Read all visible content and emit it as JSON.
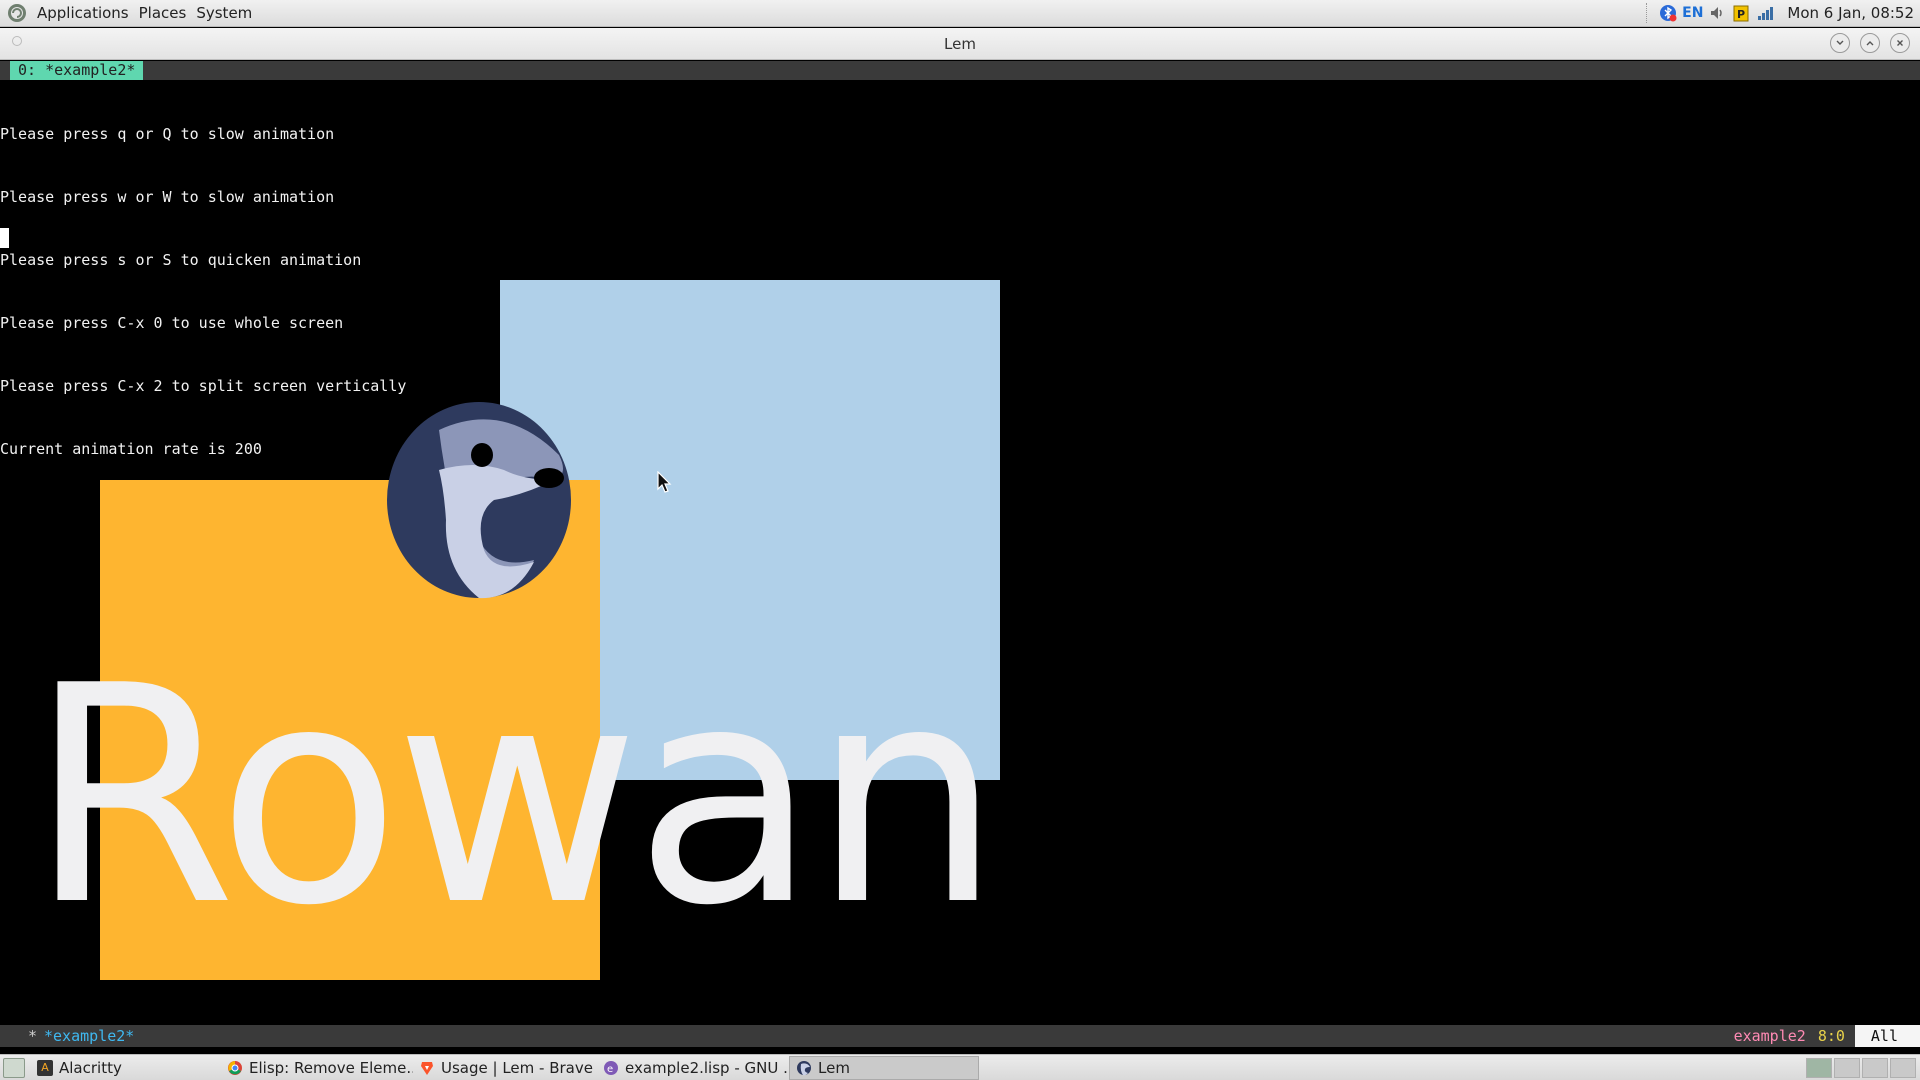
{
  "top_panel": {
    "menus": [
      "Applications",
      "Places",
      "System"
    ],
    "tray": {
      "language": "EN",
      "clock": "Mon 6 Jan, 08:52"
    }
  },
  "window": {
    "title": "Lem"
  },
  "editor": {
    "tab_label": "0: *example2*",
    "buffer_lines": [
      "Please press q or Q to slow animation",
      "Please press w or W to slow animation",
      "Please press s or S to quicken animation",
      "Please press C-x 0 to use whole screen",
      "Please press C-x 2 to split screen vertically",
      "Current animation rate is 200"
    ],
    "canvas_text": "Rowan",
    "colors": {
      "blue_square": "#b0d0e9",
      "orange_square": "#feb530",
      "text": "#f0f0f2",
      "tab": "#5fd7af"
    }
  },
  "modeline": {
    "modified_marker": "*",
    "buffer_name": "*example2*",
    "mode": "example2",
    "position": "8:0",
    "scroll": "All"
  },
  "taskbar": {
    "tasks": [
      {
        "label": "Alacritty",
        "icon": "alacritty-icon"
      },
      {
        "label": "Elisp: Remove Eleme...",
        "icon": "chrome-icon"
      },
      {
        "label": "Usage | Lem - Brave",
        "icon": "brave-icon"
      },
      {
        "label": "example2.lisp - GNU ...",
        "icon": "emacs-icon"
      },
      {
        "label": "Lem",
        "icon": "lem-icon"
      }
    ]
  }
}
